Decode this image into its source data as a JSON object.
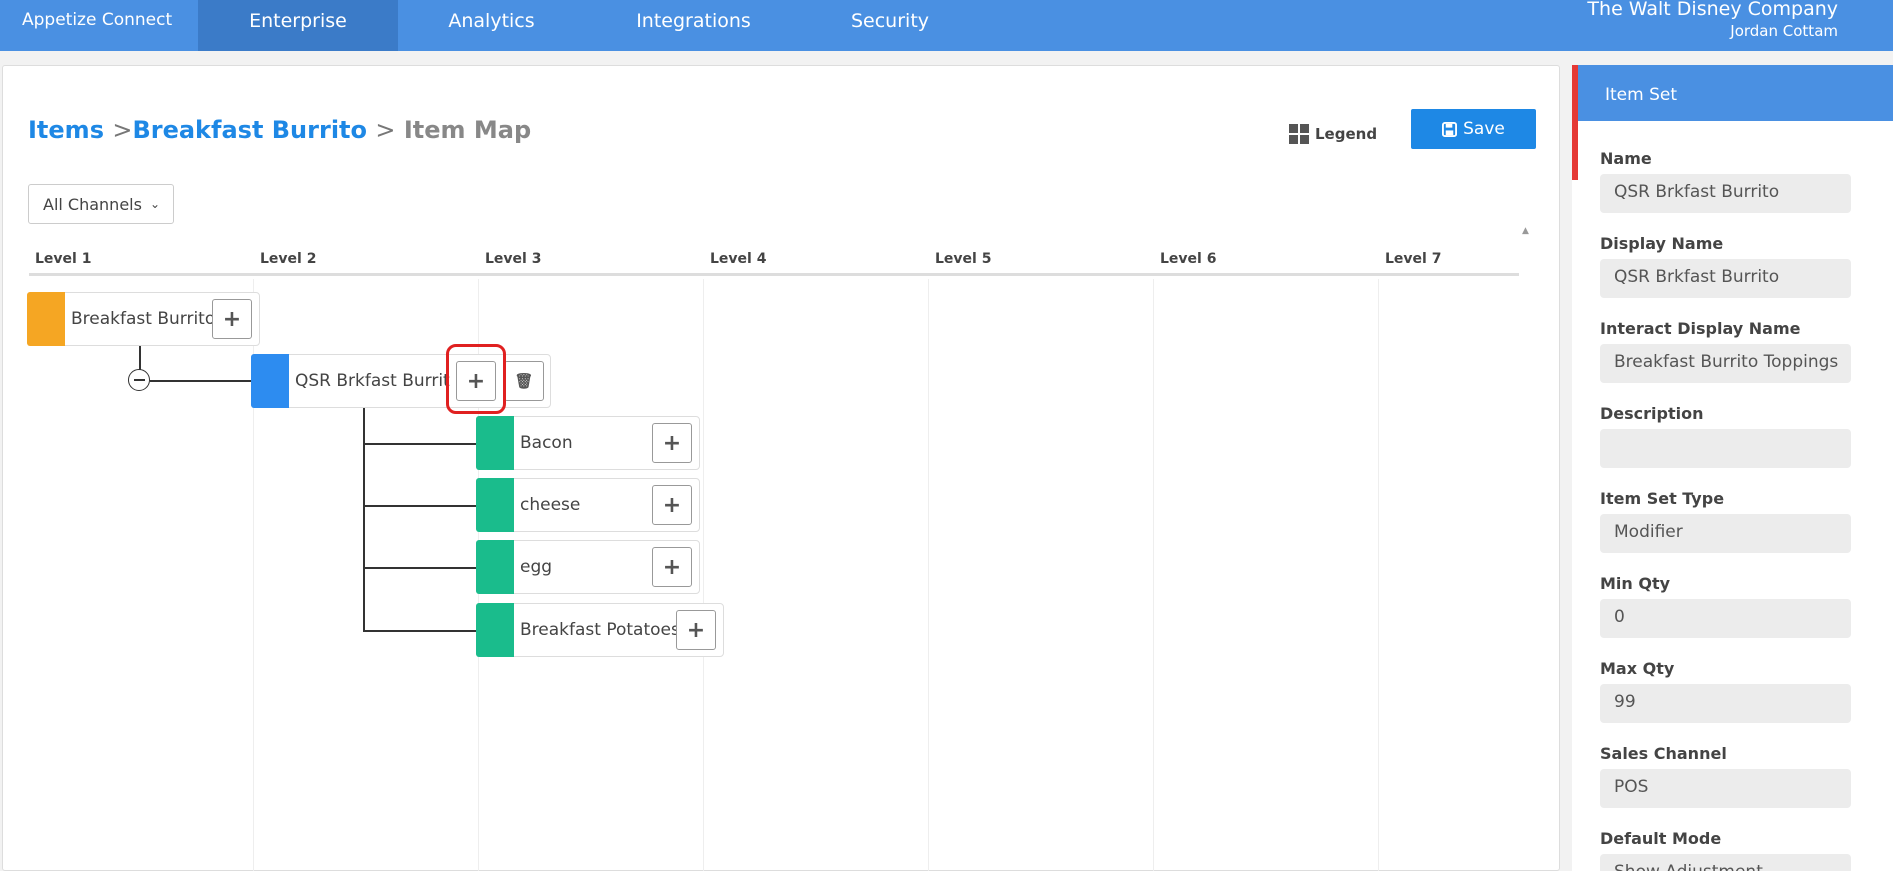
{
  "nav": {
    "brand": "Appetize Connect",
    "tabs": [
      "Enterprise",
      "Analytics",
      "Integrations",
      "Security"
    ],
    "org": "The Walt Disney Company",
    "user": "Jordan Cottam"
  },
  "breadcrumb": {
    "items": "Items",
    "item": "Breakfast Burrito",
    "current": "Item Map",
    "sep": ">"
  },
  "toolbar": {
    "legend": "Legend",
    "save": "Save"
  },
  "filter": {
    "channel": "All Channels"
  },
  "levels": [
    "Level 1",
    "Level 2",
    "Level 3",
    "Level 4",
    "Level 5",
    "Level 6",
    "Level 7"
  ],
  "tree": {
    "root": {
      "label": "Breakfast Burrito",
      "color": "#f5a623"
    },
    "set": {
      "label": "QSR Brkfast Burrito",
      "color": "#2d8cf0"
    },
    "children": [
      {
        "label": "Bacon",
        "color": "#1abc8c"
      },
      {
        "label": "cheese",
        "color": "#1abc8c"
      },
      {
        "label": "egg",
        "color": "#1abc8c"
      },
      {
        "label": "Breakfast Potatoes",
        "color": "#1abc8c"
      }
    ]
  },
  "panel": {
    "title": "Item Set",
    "fields": [
      {
        "label": "Name",
        "value": "QSR Brkfast Burrito"
      },
      {
        "label": "Display Name",
        "value": "QSR Brkfast Burrito"
      },
      {
        "label": "Interact Display Name",
        "value": "Breakfast Burrito Toppings"
      },
      {
        "label": "Description",
        "value": ""
      },
      {
        "label": "Item Set Type",
        "value": "Modifier"
      },
      {
        "label": "Min Qty",
        "value": "0"
      },
      {
        "label": "Max Qty",
        "value": "99"
      },
      {
        "label": "Sales Channel",
        "value": "POS"
      },
      {
        "label": "Default Mode",
        "value": "Show Adjustment"
      }
    ]
  },
  "icons": {
    "plus": "+",
    "trash": "🗑",
    "chevron": "⌄",
    "scroll_up": "▲"
  }
}
